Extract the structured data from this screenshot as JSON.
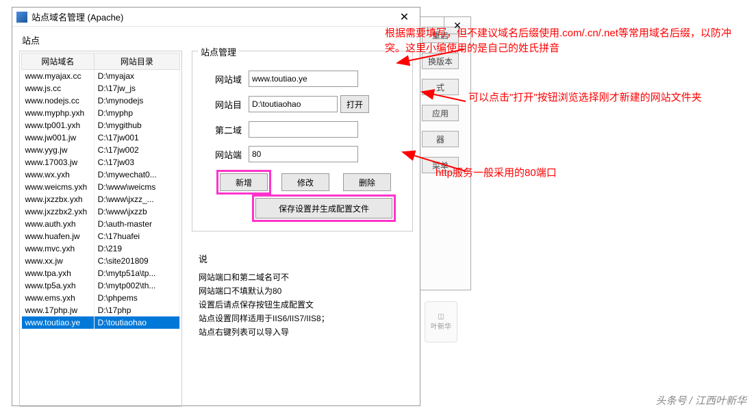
{
  "window": {
    "title": "站点域名管理 (Apache)",
    "close": "✕"
  },
  "left": {
    "label": "站点",
    "headers": [
      "网站域名",
      "网站目录"
    ],
    "rows": [
      [
        "www.myajax.cc",
        "D:\\myajax"
      ],
      [
        "www.js.cc",
        "D:\\17jw_js"
      ],
      [
        "www.nodejs.cc",
        "D:\\mynodejs"
      ],
      [
        "www.myphp.yxh",
        "D:\\myphp"
      ],
      [
        "www.tp001.yxh",
        "D:\\mygithub"
      ],
      [
        "www.jw001.jw",
        "C:\\17jw001"
      ],
      [
        "www.yyg.jw",
        "C:\\17jw002"
      ],
      [
        "www.17003.jw",
        "C:\\17jw03"
      ],
      [
        "www.wx.yxh",
        "D:\\mywechat0..."
      ],
      [
        "www.weicms.yxh",
        "D:\\www\\weicms"
      ],
      [
        "www.jxzzbx.yxh",
        "D:\\www\\jxzz_..."
      ],
      [
        "www.jxzzbx2.yxh",
        "D:\\www\\jxzzb"
      ],
      [
        "www.auth.yxh",
        "D:\\auth-master"
      ],
      [
        "www.huafen.jw",
        "C:\\17huafei"
      ],
      [
        "www.mvc.yxh",
        "D:\\219"
      ],
      [
        "www.xx.jw",
        "C:\\site201809"
      ],
      [
        "www.tpa.yxh",
        "D:\\mytp51a\\tp..."
      ],
      [
        "www.tp5a.yxh",
        "D:\\mytp002\\th..."
      ],
      [
        "www.ems.yxh",
        "D:\\phpems"
      ],
      [
        "www.17php.jw",
        "D:\\17php"
      ],
      [
        "www.toutiao.ye",
        "D:\\toutiaohao"
      ]
    ],
    "selected": 20
  },
  "mgmt": {
    "group": "站点管理",
    "fields": {
      "domain_label": "网站域",
      "domain_value": "www.toutiao.ye",
      "dir_label": "网站目",
      "dir_value": "D:\\toutiaohao",
      "open_btn": "打开",
      "second_label": "第二域",
      "second_value": "",
      "port_label": "网站端",
      "port_value": "80"
    },
    "buttons": {
      "add": "新增",
      "edit": "修改",
      "delete": "删除",
      "save": "保存设置并生成配置文件"
    }
  },
  "info": {
    "title": "说",
    "lines": [
      "网站端口和第二域名可不",
      "网站端口不填默认为80",
      "设置后请点保存按钮生成配置文",
      "站点设置同样适用于IIS6/IIS7/IIS8；",
      "站点右键列表可以导入导"
    ]
  },
  "bg_buttons": [
    "重启",
    "换版本",
    "式",
    "应用",
    "器",
    "菜单"
  ],
  "bg_label": "叶新华",
  "annotations": {
    "a1": "根据需要填写，但不建议域名后缀使用.com/.cn/.net等常用域名后缀，以防冲突。这里小编使用的是自己的姓氏拼音",
    "a2": "可以点击\"打开\"按钮浏览选择刚才新建的网站文件夹",
    "a3": "http服务一般采用的80端口"
  },
  "watermark": "头条号 / 江西叶新华"
}
